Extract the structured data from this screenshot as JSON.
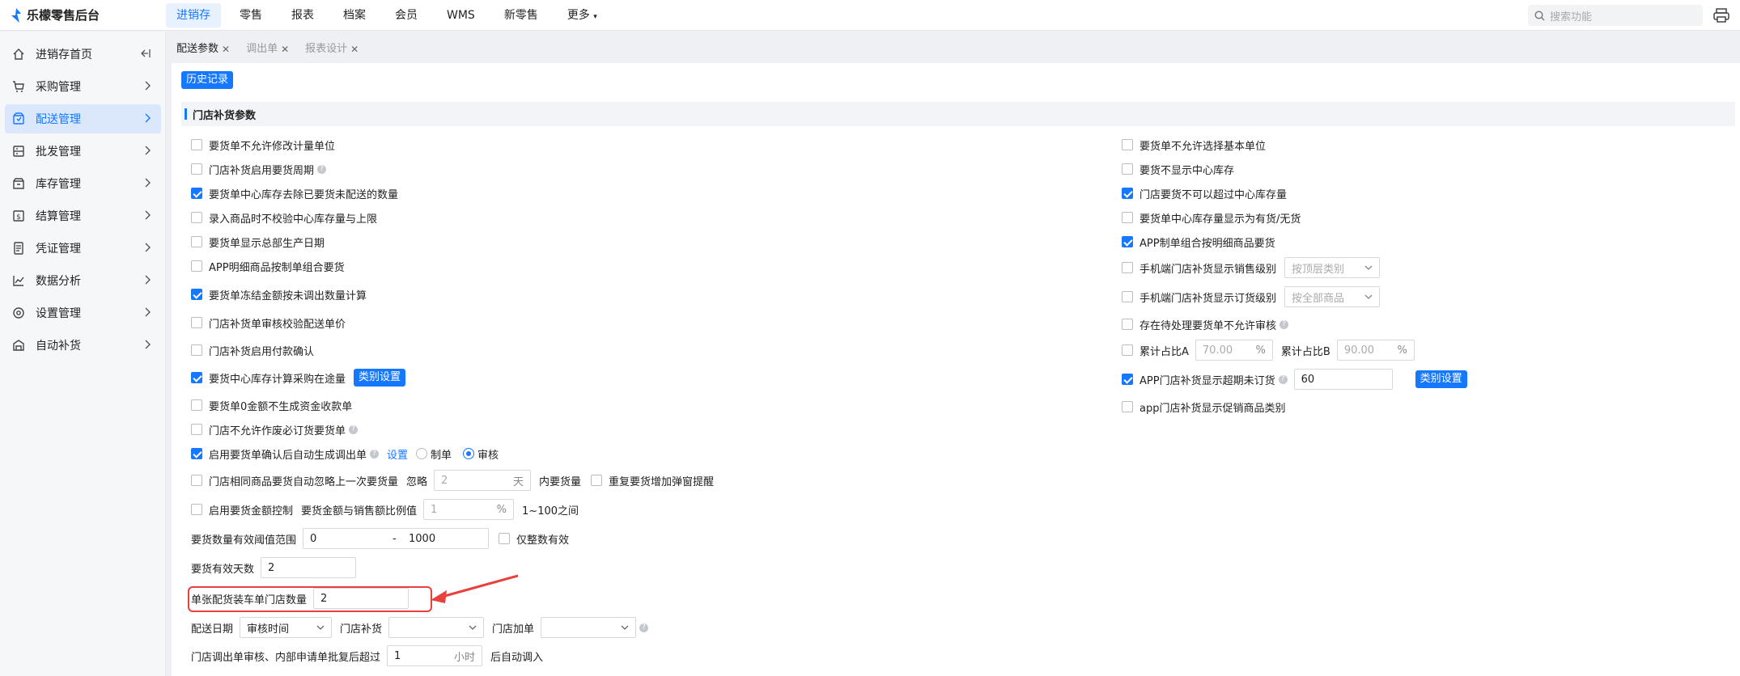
{
  "app": {
    "title": "乐檬零售后台"
  },
  "nav": {
    "items": [
      "进销存",
      "零售",
      "报表",
      "档案",
      "会员",
      "WMS",
      "新零售",
      "更多"
    ],
    "search_placeholder": "搜索功能"
  },
  "sidebar": {
    "items": [
      {
        "label": "进销存首页",
        "icon": "home-icon"
      },
      {
        "label": "采购管理",
        "icon": "cart-icon"
      },
      {
        "label": "配送管理",
        "icon": "delivery-icon"
      },
      {
        "label": "批发管理",
        "icon": "wholesale-icon"
      },
      {
        "label": "库存管理",
        "icon": "inventory-icon"
      },
      {
        "label": "结算管理",
        "icon": "settlement-icon"
      },
      {
        "label": "凭证管理",
        "icon": "voucher-icon"
      },
      {
        "label": "数据分析",
        "icon": "chart-icon"
      },
      {
        "label": "设置管理",
        "icon": "gear-icon"
      },
      {
        "label": "自动补货",
        "icon": "auto-replenish-icon"
      }
    ]
  },
  "tabs": [
    "配送参数",
    "调出单",
    "报表设计"
  ],
  "page": {
    "history_button": "历史记录",
    "section_title": "门店补货参数"
  },
  "left_options": {
    "o1": "要货单不允许修改计量单位",
    "o2": "门店补货启用要货周期",
    "o3": "要货单中心库存去除已要货未配送的数量",
    "o4": "录入商品时不校验中心库存量与上限",
    "o5": "要货单显示总部生产日期",
    "o6": "APP明细商品按制单组合要货",
    "o7": "要货单冻结金额按未调出数量计算",
    "o8": "门店补货单审核校验配送单价",
    "o9": "门店补货启用付款确认",
    "o10": "要货中心库存计算采购在途量",
    "o10_button": "类别设置",
    "o11": "要货单0金额不生成资金收款单",
    "o12": "门店不允许作废必订货要货单",
    "o13": "启用要货单确认后自动生成调出单",
    "o13_link": "设置",
    "o13_radio1": "制单",
    "o13_radio2": "审核",
    "o14": "门店相同商品要货自动忽略上一次要货量",
    "o14_ignore": "忽略",
    "o14_value": "2",
    "o14_unit": "天",
    "o14_after": "内要货量",
    "o14_cb2": "重复要货增加弹窗提醒",
    "o15": "启用要货金额控制",
    "o15_label": "要货金额与销售额比例值",
    "o15_value": "1",
    "o15_unit": "%",
    "o15_after": "1~100之间",
    "o16_label": "要货数量有效阈值范围",
    "o16_min": "0",
    "o16_sep": "-",
    "o16_max": "1000",
    "o16_cb": "仅整数有效",
    "o17_label": "要货有效天数",
    "o17_value": "2",
    "o18_label": "单张配货装车单门店数量",
    "o18_value": "2",
    "o19_label": "配送日期",
    "o19_value": "审核时间",
    "o19_label2": "门店补货",
    "o19_label3": "门店加单",
    "o20_label": "门店调出单审核、内部申请单批复后超过",
    "o20_value": "1",
    "o20_unit": "小时",
    "o20_after": "后自动调入"
  },
  "right_options": {
    "r1": "要货单不允许选择基本单位",
    "r2": "要货不显示中心库存",
    "r3": "门店要货不可以超过中心库存量",
    "r4": "要货单中心库存量显示为有货/无货",
    "r5": "APP制单组合按明细商品要货",
    "r6": "手机端门店补货显示销售级别",
    "r6_select": "按顶层类别",
    "r7": "手机端门店补货显示订货级别",
    "r7_select": "按全部商品",
    "r8": "存在待处理要货单不允许审核",
    "r9": "累计占比A",
    "r9_value": "70.00",
    "r9_unit": "%",
    "r9_label2": "累计占比B",
    "r9_value2": "90.00",
    "r9_unit2": "%",
    "r10": "APP门店补货显示超期未订货",
    "r10_value": "60",
    "r10_button": "类别设置",
    "r11": "app门店补货显示促销商品类别"
  },
  "colors": {
    "accent": "#1677ff",
    "highlight": "#e8403c"
  }
}
